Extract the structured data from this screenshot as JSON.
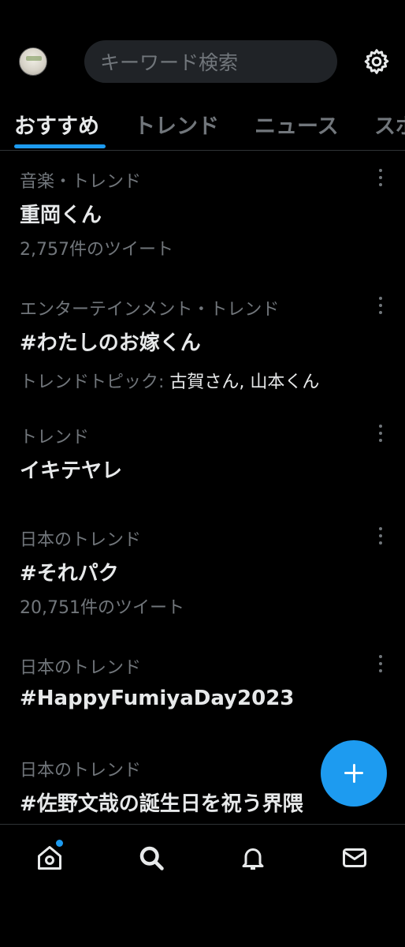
{
  "search": {
    "placeholder": "キーワード検索"
  },
  "tabs": [
    {
      "label": "おすすめ",
      "active": true
    },
    {
      "label": "トレンド",
      "active": false
    },
    {
      "label": "ニュース",
      "active": false
    },
    {
      "label": "スポ",
      "active": false
    }
  ],
  "trends": [
    {
      "meta": "音楽・トレンド",
      "title": "重岡くん",
      "sub": "2,757件のツイート"
    },
    {
      "meta": "エンターテインメント・トレンド",
      "title": "#わたしのお嫁くん",
      "sub_label": "トレンドトピック: ",
      "sub_topics": "古賀さん, 山本くん"
    },
    {
      "meta": "トレンド",
      "title": "イキテヤレ"
    },
    {
      "meta": "日本のトレンド",
      "title": "#それパク",
      "sub": "20,751件のツイート"
    },
    {
      "meta": "日本のトレンド",
      "title": "#HappyFumiyaDay2023"
    },
    {
      "meta": "日本のトレンド",
      "title": "#佐野文哉の誕生日を祝う界隈"
    }
  ],
  "icons": {
    "settings": "gear-icon",
    "more": "more-vertical-icon",
    "compose": "plus-icon",
    "home": "home-icon",
    "search": "search-icon",
    "notifications": "bell-icon",
    "messages": "mail-icon"
  },
  "colors": {
    "accent": "#1d9bf0",
    "background": "#000000",
    "muted": "#71767b",
    "text": "#e7e9ea"
  }
}
